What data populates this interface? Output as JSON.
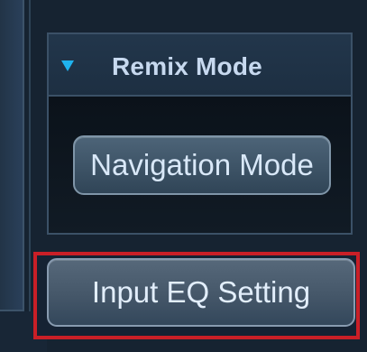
{
  "remix": {
    "section_title": "Remix Mode",
    "collapse_icon": "triangle-down-icon",
    "navigation_button_label": "Navigation Mode"
  },
  "input_eq": {
    "button_label": "Input EQ Setting",
    "highlight_color": "#c91f27"
  },
  "colors": {
    "accent": "#1fb3ee",
    "panel_bg": "#162331",
    "button_text": "#d9e8f8"
  }
}
